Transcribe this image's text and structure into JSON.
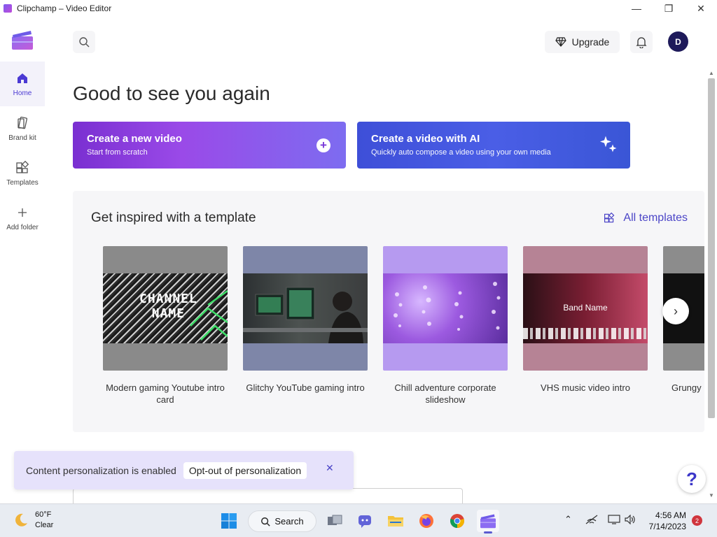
{
  "window": {
    "title": "Clipchamp – Video Editor",
    "minimize_glyph": "—",
    "maximize_glyph": "❐",
    "close_glyph": "✕"
  },
  "sidebar": {
    "items": [
      {
        "label": "Home",
        "icon": "home-icon",
        "active": true
      },
      {
        "label": "Brand kit",
        "icon": "brand-kit-icon"
      },
      {
        "label": "Templates",
        "icon": "templates-icon"
      },
      {
        "label": "Add folder",
        "icon": "add-icon"
      }
    ]
  },
  "header": {
    "upgrade_label": "Upgrade",
    "avatar_initial": "D"
  },
  "main": {
    "greeting": "Good to see you again",
    "cta_new": {
      "title": "Create a new video",
      "subtitle": "Start from scratch",
      "icon_glyph": "+"
    },
    "cta_ai": {
      "title": "Create a video with AI",
      "subtitle": "Quickly auto compose a video using your own media"
    }
  },
  "templates": {
    "title": "Get inspired with a template",
    "all_label": "All templates",
    "items": [
      {
        "name": "Modern gaming Youtube intro card",
        "bg": "#8a8a8a",
        "overlay_text": "CHANNEL\nNAME"
      },
      {
        "name": "Glitchy YouTube gaming intro",
        "bg": "#7e86a8"
      },
      {
        "name": "Chill adventure corporate slideshow",
        "bg": "#b69af0"
      },
      {
        "name": "VHS music video intro",
        "bg": "#b68395",
        "overlay_text": "Band Name"
      },
      {
        "name": "Grungy",
        "bg": "#8c8c8c"
      }
    ],
    "next_glyph": "›"
  },
  "toast": {
    "message": "Content personalization is enabled",
    "optout_label": "Opt-out of personalization",
    "close_glyph": "✕"
  },
  "help_glyph": "?",
  "taskbar": {
    "weather_temp": "60°F",
    "weather_desc": "Clear",
    "search_label": "Search",
    "time": "4:56 AM",
    "date": "7/14/2023",
    "notification_count": "2"
  },
  "colors": {
    "accent": "#4b45c7",
    "cta_new_start": "#7a2fd1",
    "cta_ai": "#3e4fd8",
    "avatar": "#1e1a5a"
  }
}
